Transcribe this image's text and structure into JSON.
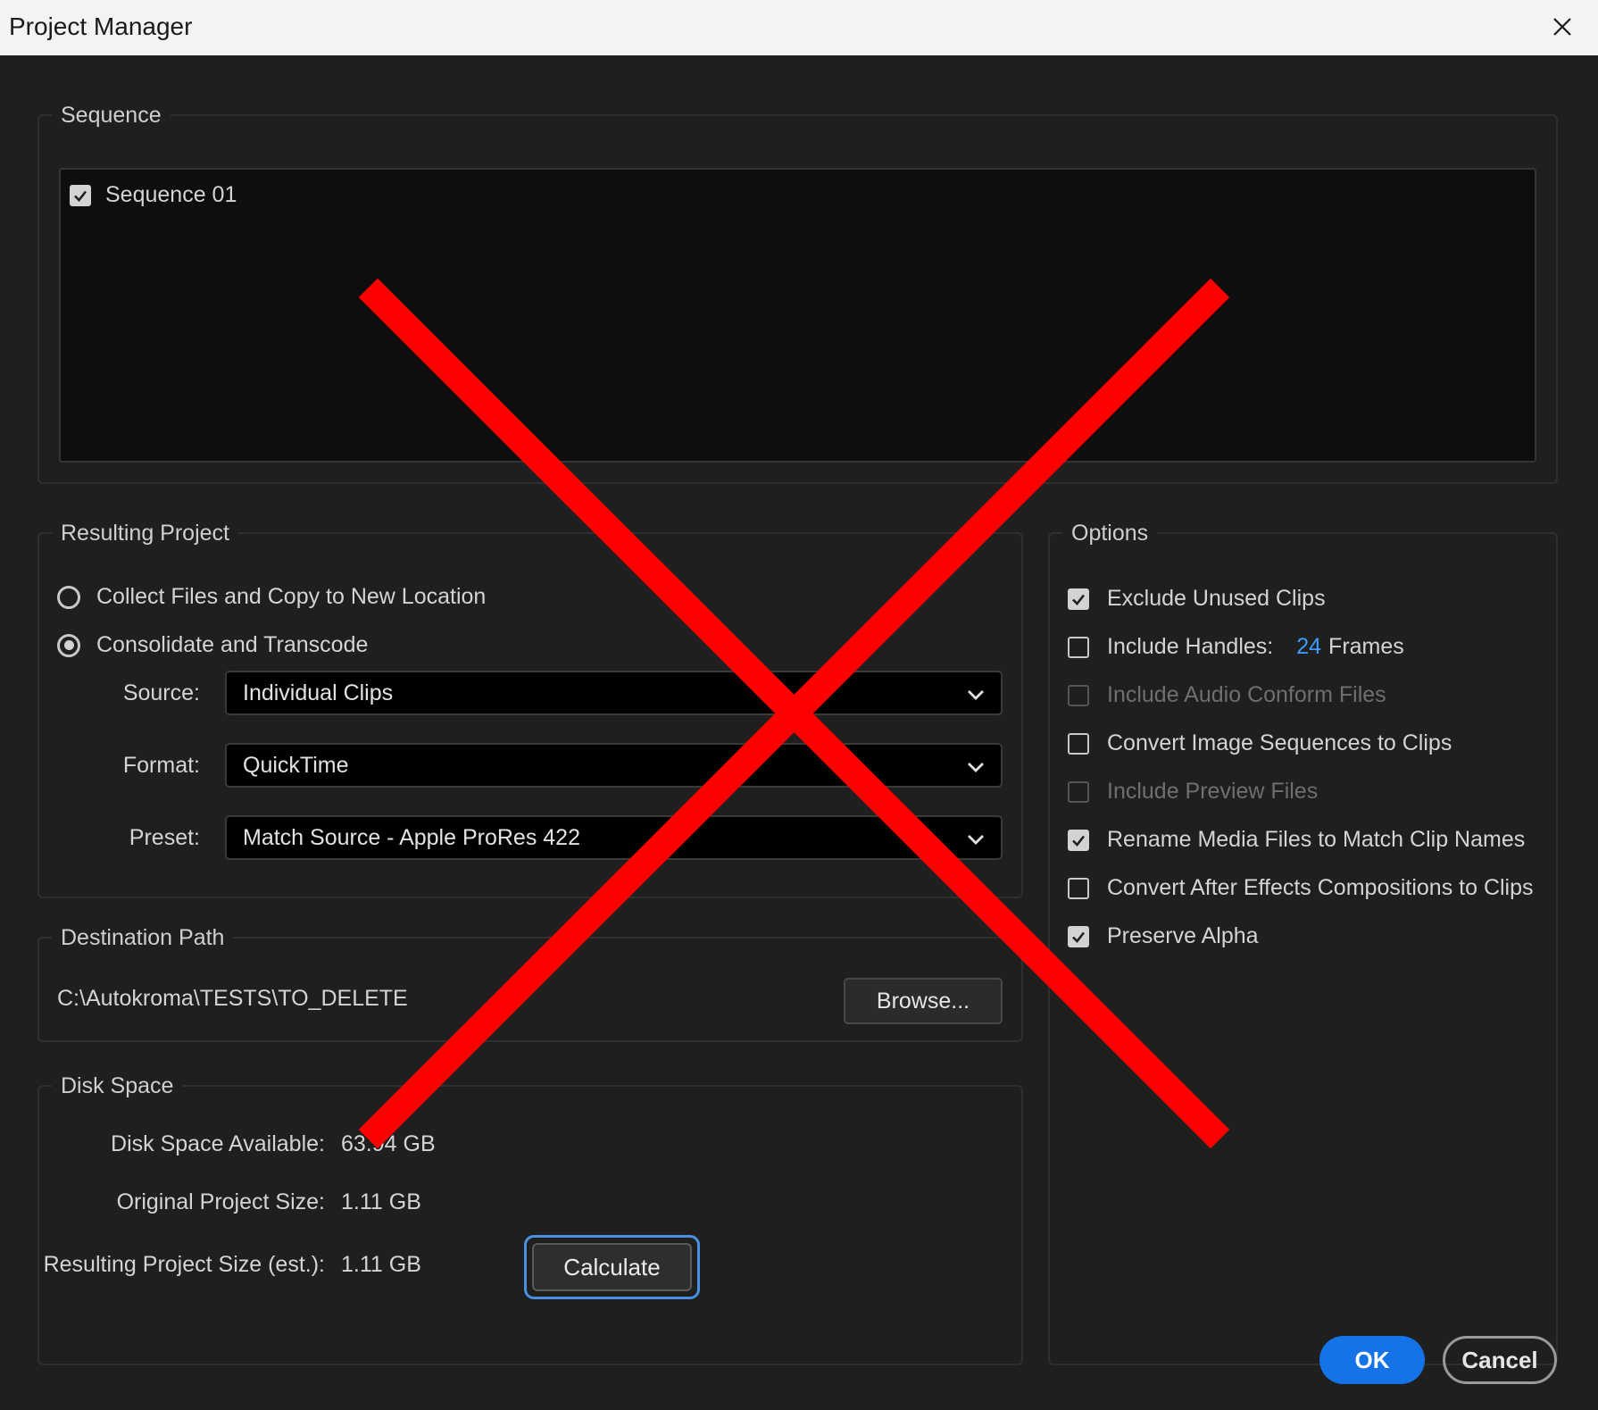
{
  "window": {
    "title": "Project Manager"
  },
  "sequence": {
    "legend": "Sequence",
    "items": [
      {
        "label": "Sequence 01",
        "checked": true
      }
    ]
  },
  "resulting_project": {
    "legend": "Resulting Project",
    "options": [
      {
        "label": "Collect Files and Copy to New Location",
        "selected": false
      },
      {
        "label": "Consolidate and Transcode",
        "selected": true
      }
    ],
    "source": {
      "label": "Source:",
      "value": "Individual Clips"
    },
    "format": {
      "label": "Format:",
      "value": "QuickTime"
    },
    "preset": {
      "label": "Preset:",
      "value": "Match Source - Apple ProRes 422"
    }
  },
  "destination": {
    "legend": "Destination Path",
    "path": "C:\\Autokroma\\TESTS\\TO_DELETE",
    "browse_label": "Browse..."
  },
  "disk_space": {
    "legend": "Disk Space",
    "available_label": "Disk Space Available:",
    "available_value": "63.94 GB",
    "original_label": "Original Project Size:",
    "original_value": "1.11 GB",
    "resulting_label": "Resulting Project Size (est.):",
    "resulting_value": "1.11 GB",
    "calculate_label": "Calculate"
  },
  "options": {
    "legend": "Options",
    "exclude_unused": {
      "label": "Exclude Unused Clips",
      "checked": true,
      "disabled": false
    },
    "include_handles": {
      "label": "Include Handles:",
      "checked": false,
      "value": "24",
      "unit": "Frames"
    },
    "include_audio_conform": {
      "label": "Include Audio Conform Files",
      "checked": false,
      "disabled": true
    },
    "convert_image_sequences": {
      "label": "Convert Image Sequences to Clips",
      "checked": false,
      "disabled": false
    },
    "include_preview": {
      "label": "Include Preview Files",
      "checked": false,
      "disabled": true
    },
    "rename_media": {
      "label": "Rename Media Files to Match Clip Names",
      "checked": true,
      "disabled": false
    },
    "convert_ae": {
      "label": "Convert After Effects Compositions to Clips",
      "checked": false,
      "disabled": false
    },
    "preserve_alpha": {
      "label": "Preserve Alpha",
      "checked": true,
      "disabled": false
    }
  },
  "footer": {
    "ok_label": "OK",
    "cancel_label": "Cancel"
  },
  "colors": {
    "accent": "#1473e6",
    "link": "#3e9bff",
    "overlay_cross": "#ff0000",
    "focus_ring": "#4a90e2"
  }
}
